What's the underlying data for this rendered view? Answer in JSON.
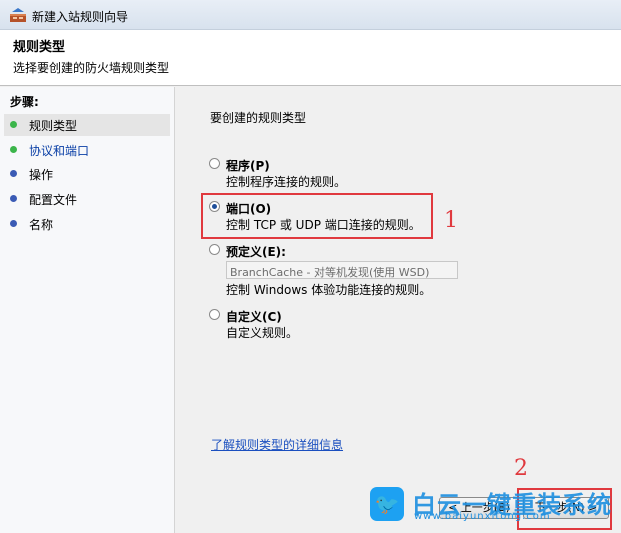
{
  "window": {
    "title": "新建入站规则向导",
    "icon": "firewall-wizard-icon"
  },
  "header": {
    "title": "规则类型",
    "subtitle": "选择要创建的防火墙规则类型"
  },
  "sidebar": {
    "title": "步骤:",
    "items": [
      {
        "label": "规则类型",
        "dot_color": "#3bb54a",
        "active": true
      },
      {
        "label": "协议和端口",
        "dot_color": "#3bb54a",
        "active": false
      },
      {
        "label": "操作",
        "dot_color": "#3b5bb5",
        "active": false
      },
      {
        "label": "配置文件",
        "dot_color": "#3b5bb5",
        "active": false
      },
      {
        "label": "名称",
        "dot_color": "#3b5bb5",
        "active": false
      }
    ]
  },
  "main": {
    "question": "要创建的规则类型",
    "options": [
      {
        "name": "程序(P)",
        "desc": "控制程序连接的规则。",
        "selected": false
      },
      {
        "name": "端口(O)",
        "desc": "控制 TCP 或 UDP 端口连接的规则。",
        "selected": true
      },
      {
        "name": "预定义(E):",
        "select_value": "BranchCache - 对等机发现(使用 WSD)",
        "desc": "控制 Windows 体验功能连接的规则。",
        "selected": false
      },
      {
        "name": "自定义(C)",
        "desc": "自定义规则。",
        "selected": false
      }
    ],
    "learn_more": "了解规则类型的详细信息"
  },
  "annotations": {
    "mark1": "1",
    "mark2": "2",
    "color": "#e0393e"
  },
  "buttons": {
    "back": "< 上一步(B)",
    "next": "下一步(N) >"
  },
  "watermark": {
    "text": "白云一键重装系统",
    "url": "www.baiyunxitong.com",
    "icon": "twitter-bird-icon"
  }
}
